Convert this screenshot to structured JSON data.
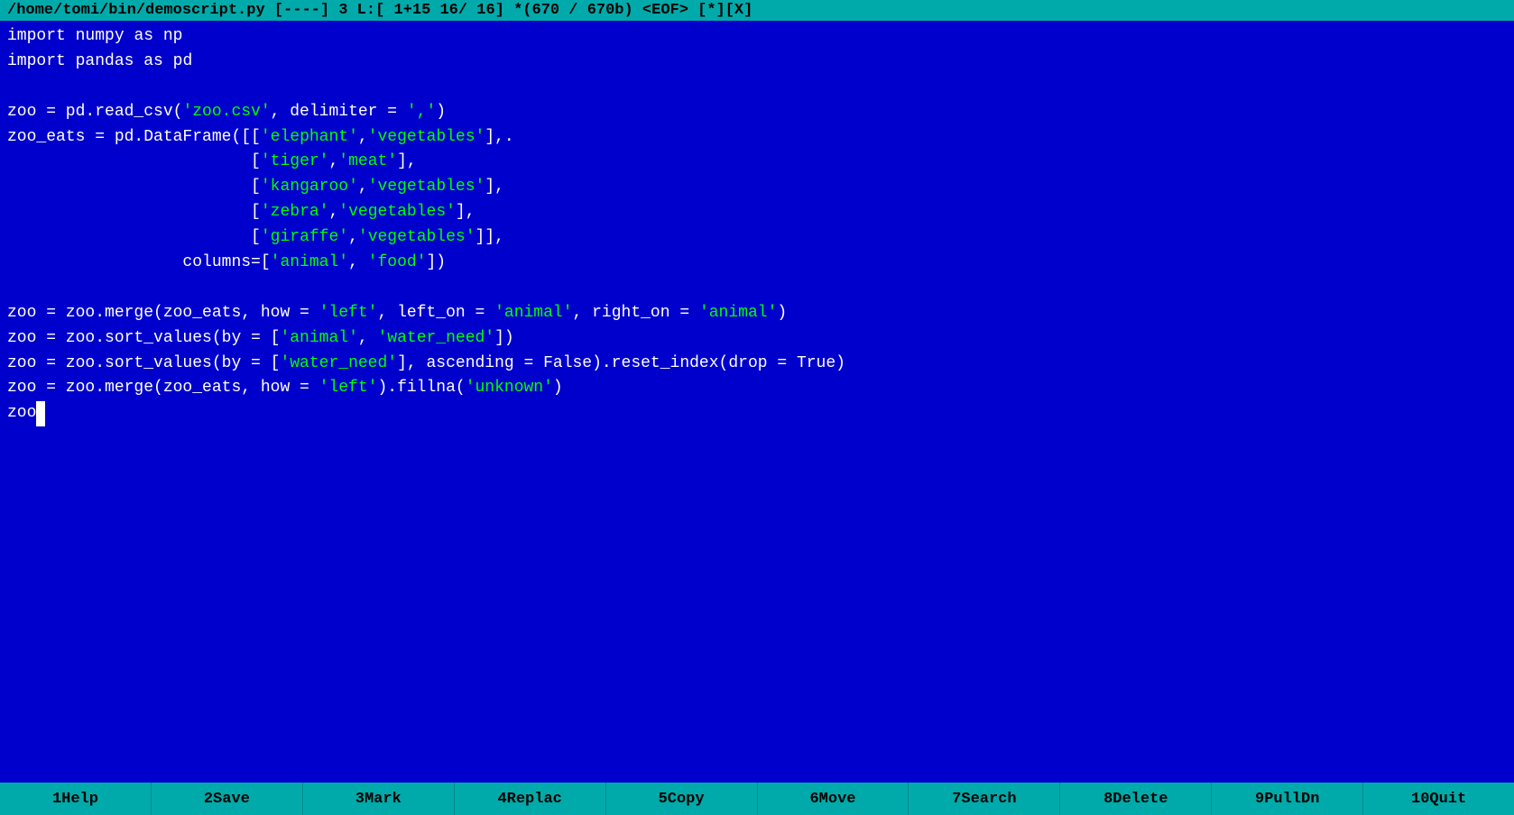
{
  "titlebar": {
    "text": "/home/tomi/bin/demoscript.py      [----]    3 L:[    1+15   16/ 16] *(670 / 670b) <EOF>                              [*][X]"
  },
  "code": {
    "lines": [
      {
        "id": 1,
        "content": "import numpy as np"
      },
      {
        "id": 2,
        "content": "import pandas as pd"
      },
      {
        "id": 3,
        "content": ""
      },
      {
        "id": 4,
        "content": "zoo = pd.read_csv('zoo.csv', delimiter = ',')"
      },
      {
        "id": 5,
        "content": "zoo_eats = pd.DataFrame([['elephant','vegetables'],."
      },
      {
        "id": 6,
        "content": "                         ['tiger','meat'],"
      },
      {
        "id": 7,
        "content": "                         ['kangaroo','vegetables'],"
      },
      {
        "id": 8,
        "content": "                         ['zebra','vegetables'],"
      },
      {
        "id": 9,
        "content": "                         ['giraffe','vegetables']],"
      },
      {
        "id": 10,
        "content": "                  columns=['animal', 'food'])"
      },
      {
        "id": 11,
        "content": ""
      },
      {
        "id": 12,
        "content": "zoo = zoo.merge(zoo_eats, how = 'left', left_on = 'animal', right_on = 'animal')"
      },
      {
        "id": 13,
        "content": "zoo = zoo.sort_values(by = ['animal', 'water_need'])"
      },
      {
        "id": 14,
        "content": "zoo = zoo.sort_values(by = ['water_need'], ascending = False).reset_index(drop = True)"
      },
      {
        "id": 15,
        "content": "zoo = zoo.merge(zoo_eats, how = 'left').fillna('unknown')"
      },
      {
        "id": 16,
        "content": "zoo█"
      }
    ]
  },
  "bottombar": {
    "buttons": [
      {
        "num": "1",
        "label": "Help"
      },
      {
        "num": "2",
        "label": "Save"
      },
      {
        "num": "3",
        "label": "Mark"
      },
      {
        "num": "4",
        "label": "Replac"
      },
      {
        "num": "5",
        "label": "Copy"
      },
      {
        "num": "6",
        "label": "Move"
      },
      {
        "num": "7",
        "label": "Search"
      },
      {
        "num": "8",
        "label": "Delete"
      },
      {
        "num": "9",
        "label": "PullDn"
      },
      {
        "num": "10",
        "label": "Quit"
      }
    ]
  }
}
